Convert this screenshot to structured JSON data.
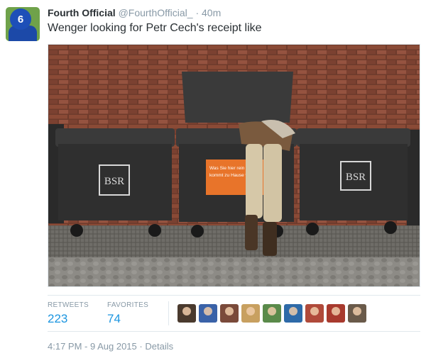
{
  "tweet": {
    "name": "Fourth Official",
    "handle": "@FourthOfficial_",
    "separator": "·",
    "time": "40m",
    "text": "Wenger looking for Petr Cech's receipt like",
    "avatar_number": "6"
  },
  "photo": {
    "bin_logo": "BSR",
    "sign_lines": [
      "Was Sie hier rein",
      "kommt zu Hause w"
    ]
  },
  "stats": {
    "retweets_label": "RETWEETS",
    "retweets_value": "223",
    "favorites_label": "FAVORITES",
    "favorites_value": "74",
    "favoriters": [
      {
        "icon": "user-avatar",
        "color": "#4a3a2e"
      },
      {
        "icon": "user-avatar",
        "color": "#3a62a8"
      },
      {
        "icon": "user-avatar",
        "color": "#7a4a3a"
      },
      {
        "icon": "user-avatar",
        "color": "#c8a060"
      },
      {
        "icon": "user-avatar",
        "color": "#5a8a4a"
      },
      {
        "icon": "user-avatar",
        "color": "#2e6aa8"
      },
      {
        "icon": "user-avatar",
        "color": "#b04a3a"
      },
      {
        "icon": "user-avatar",
        "color": "#a83a2e"
      },
      {
        "icon": "user-avatar",
        "color": "#6a5a4a"
      }
    ]
  },
  "meta": {
    "timestamp": "4:17 PM - 9 Aug 2015",
    "separator": "·",
    "details_link": "Details"
  }
}
